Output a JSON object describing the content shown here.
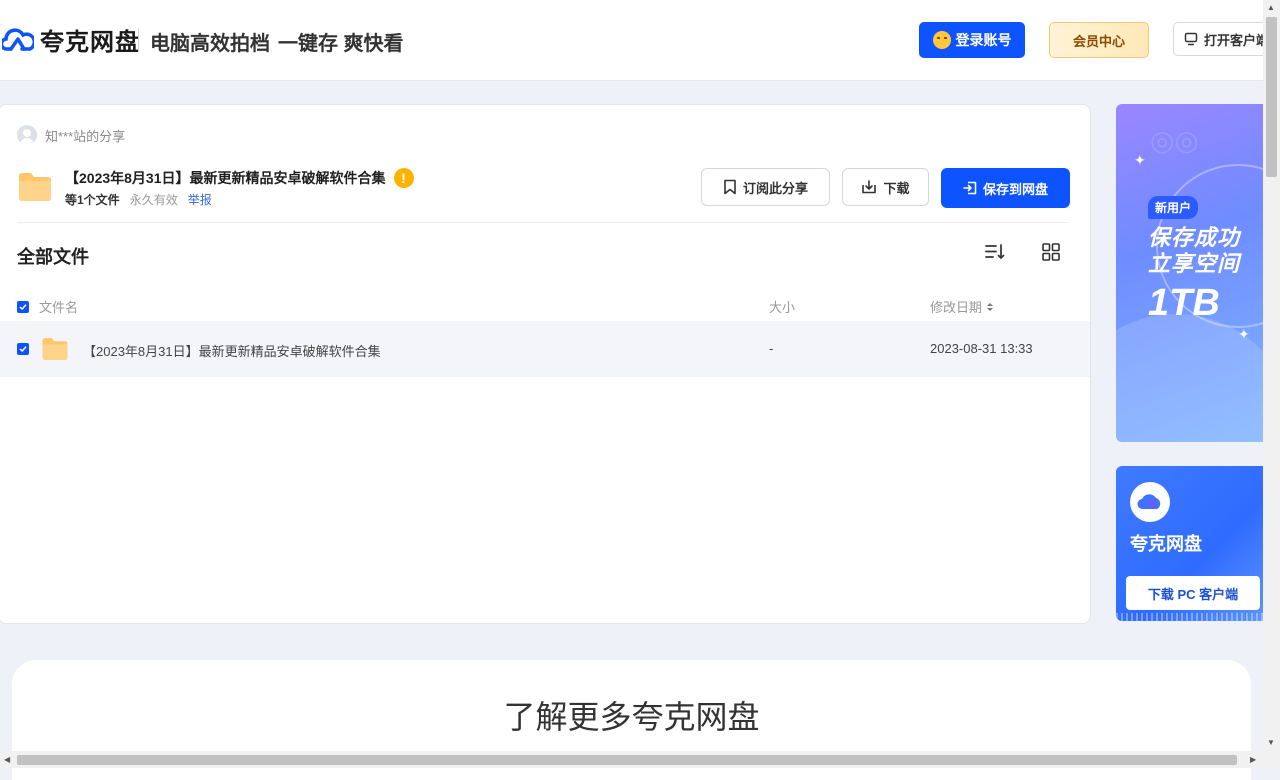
{
  "header": {
    "logo_text": "夸克网盘",
    "slogan_1": "电脑高效拍档",
    "slogan_2": "一键存 爽快看",
    "login_label": "登录账号",
    "vip_label": "会员中心",
    "client_label": "打开客户端"
  },
  "share": {
    "sharer": "知***站的分享",
    "title": "【2023年8月31日】最新更新精品安卓破解软件合集",
    "file_count": "等1个文件",
    "validity": "永久有效",
    "report": "举报",
    "subscribe_label": "订阅此分享",
    "download_label": "下载",
    "save_label": "保存到网盘"
  },
  "files": {
    "section_title": "全部文件",
    "columns": {
      "name": "文件名",
      "size": "大小",
      "modified": "修改日期"
    },
    "rows": [
      {
        "name": "【2023年8月31日】最新更新精品安卓破解软件合集",
        "size": "-",
        "modified": "2023-08-31 13:33"
      }
    ]
  },
  "ads": {
    "promo_badge": "新用户",
    "promo_line1": "保存成功",
    "promo_line2": "立享空间",
    "promo_size": "1TB",
    "app_name": "夸克网盘",
    "download_pc": "下载 PC 客户端"
  },
  "bottom": {
    "title": "了解更多夸克网盘"
  },
  "colors": {
    "accent": "#0d53ff",
    "warning": "#ffb300",
    "folder": "#ffc66b"
  }
}
